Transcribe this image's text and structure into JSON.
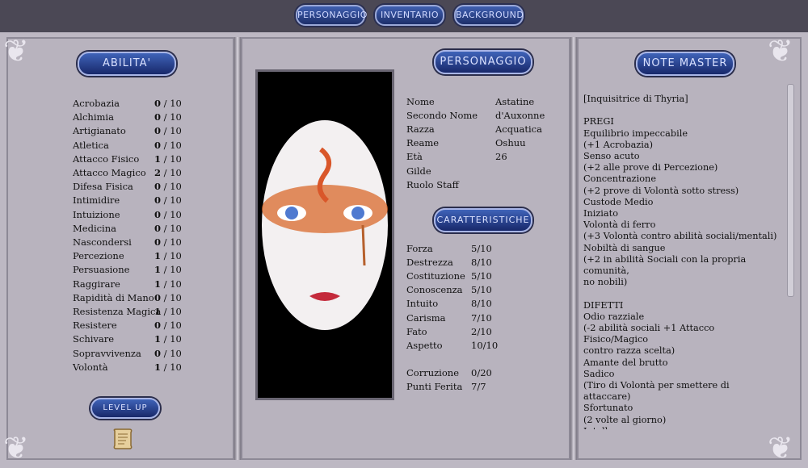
{
  "top_nav": {
    "personaggio": "PERSONAGGIO",
    "inventario": "INVENTARIO",
    "background": "BACKGROUND"
  },
  "left_panel": {
    "title": "ABILITA'",
    "skills": [
      {
        "name": "Acrobazia",
        "value": "0",
        "max": "10"
      },
      {
        "name": "Alchimia",
        "value": "0",
        "max": "10"
      },
      {
        "name": "Artigianato",
        "value": "0",
        "max": "10"
      },
      {
        "name": "Atletica",
        "value": "0",
        "max": "10"
      },
      {
        "name": "Attacco Fisico",
        "value": "1",
        "max": "10"
      },
      {
        "name": "Attacco Magico",
        "value": "2",
        "max": "10"
      },
      {
        "name": "Difesa Fisica",
        "value": "0",
        "max": "10"
      },
      {
        "name": "Intimidire",
        "value": "0",
        "max": "10"
      },
      {
        "name": "Intuizione",
        "value": "0",
        "max": "10"
      },
      {
        "name": "Medicina",
        "value": "0",
        "max": "10"
      },
      {
        "name": "Nascondersi",
        "value": "0",
        "max": "10"
      },
      {
        "name": "Percezione",
        "value": "1",
        "max": "10"
      },
      {
        "name": "Persuasione",
        "value": "1",
        "max": "10"
      },
      {
        "name": "Raggirare",
        "value": "1",
        "max": "10"
      },
      {
        "name": "Rapidità di Mano",
        "value": "0",
        "max": "10"
      },
      {
        "name": "Resistenza Magica",
        "value": "1",
        "max": "10"
      },
      {
        "name": "Resistere",
        "value": "0",
        "max": "10"
      },
      {
        "name": "Schivare",
        "value": "1",
        "max": "10"
      },
      {
        "name": "Sopravvivenza",
        "value": "0",
        "max": "10"
      },
      {
        "name": "Volontà",
        "value": "1",
        "max": "10"
      }
    ],
    "level_up": "LEVEL UP"
  },
  "center_panel": {
    "title": "PERSONAGGIO",
    "info": [
      {
        "label": "Nome",
        "value": "Astatine"
      },
      {
        "label": "Secondo Nome",
        "value": "d'Auxonne"
      },
      {
        "label": "Razza",
        "value": "Acquatica"
      },
      {
        "label": "Reame",
        "value": "Oshuu"
      },
      {
        "label": "Età",
        "value": "26"
      },
      {
        "label": "Gilde",
        "value": ""
      },
      {
        "label": "Ruolo Staff",
        "value": ""
      }
    ],
    "traits_title": "CARATTERISTICHE",
    "traits": [
      {
        "label": "Forza",
        "value": "5/10"
      },
      {
        "label": "Destrezza",
        "value": "8/10"
      },
      {
        "label": "Costituzione",
        "value": "5/10"
      },
      {
        "label": "Conoscenza",
        "value": "5/10"
      },
      {
        "label": "Intuito",
        "value": "8/10"
      },
      {
        "label": "Carisma",
        "value": "7/10"
      },
      {
        "label": "Fato",
        "value": "2/10"
      },
      {
        "label": "Aspetto",
        "value": "10/10"
      }
    ],
    "extra": [
      {
        "label": "Corruzione",
        "value": "0/20"
      },
      {
        "label": "Punti Ferita",
        "value": "7/7"
      }
    ]
  },
  "right_panel": {
    "title": "NOTE MASTER",
    "notes": "[Inquisitrice di Thyria]\n\nPREGI\nEquilibrio impeccabile\n(+1 Acrobazia)\nSenso acuto\n(+2 alle prove di Percezione)\nConcentrazione\n(+2 prove di Volontà sotto stress)\nCustode Medio\nIniziato\nVolontà di ferro\n(+3 Volontà contro abilità sociali/mentali)\nNobiltà di sangue\n(+2 in abilità Sociali con la propria comunità,\nno nobili)\n\nDIFETTI\nOdio razziale\n(-2 abilità sociali +1 Attacco Fisico/Magico\ncontro razza scelta)\nAmante del brutto\nSadico\n(Tiro di Volontà per smettere di attaccare)\nSfortunato\n(2 volte al giorno)\nIntolleranza\n\nMAESTRIE RAZZIALI\nPinna perfetta"
  },
  "colors": {
    "accent_blue": "#2a4496",
    "panel_bg": "#b8b3be",
    "topbar_bg": "#4b4855"
  }
}
